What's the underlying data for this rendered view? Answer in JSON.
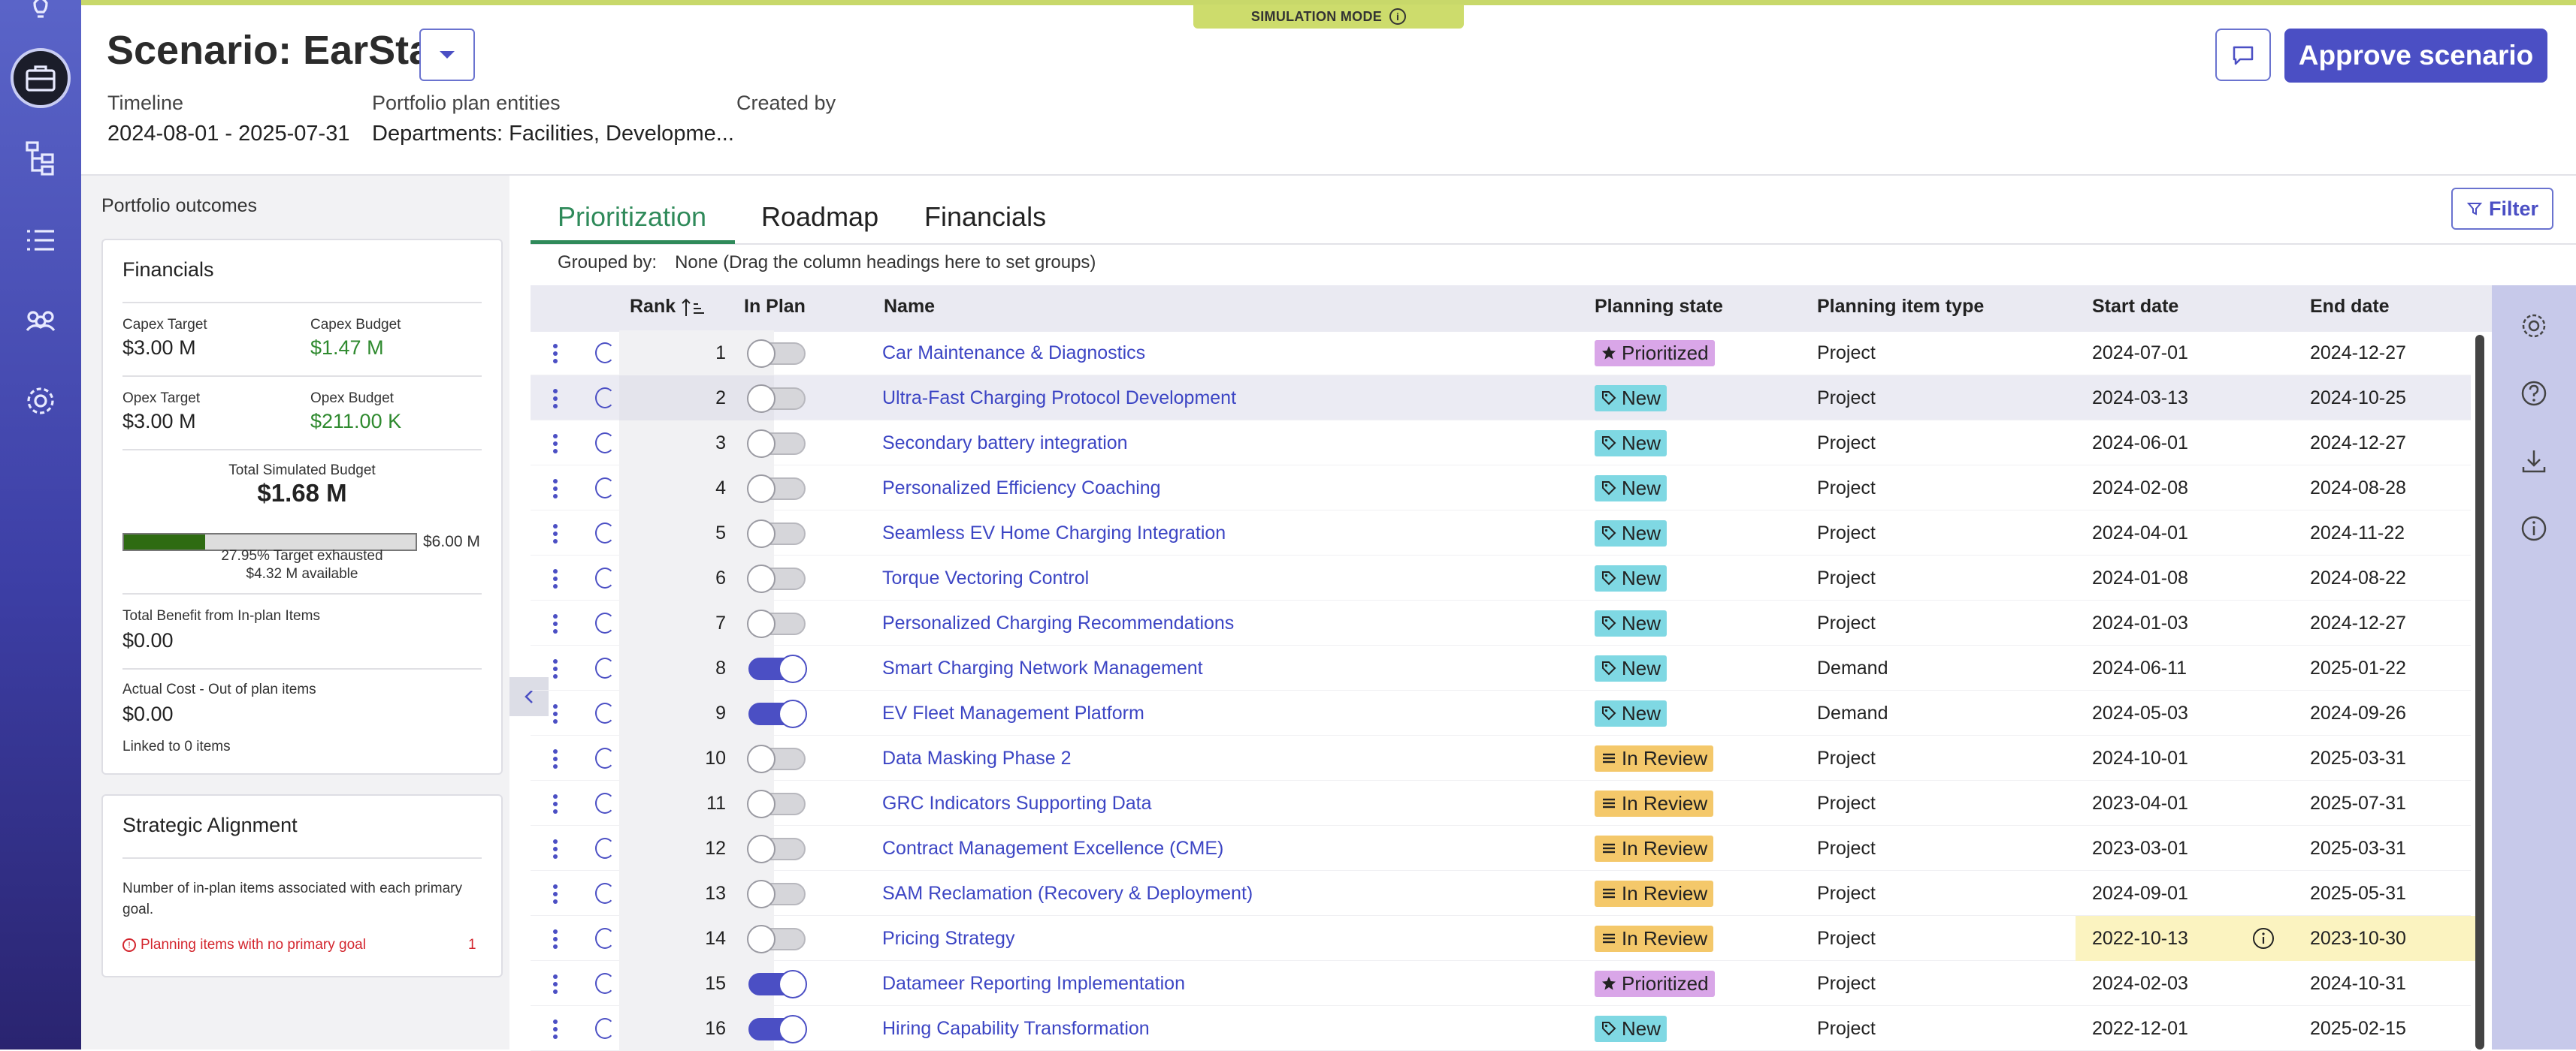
{
  "sim_mode": "SIMULATION MODE",
  "header": {
    "title": "Scenario: EarSta",
    "timeline_label": "Timeline",
    "timeline_value": "2024-08-01 - 2025-07-31",
    "entities_label": "Portfolio plan entities",
    "entities_value": "Departments: Facilities, Developme...",
    "created_label": "Created by",
    "approve_label": "Approve scenario"
  },
  "left_panel": {
    "title": "Portfolio outcomes",
    "financials": {
      "heading": "Financials",
      "capex_target_label": "Capex Target",
      "capex_target": "$3.00 M",
      "capex_budget_label": "Capex Budget",
      "capex_budget": "$1.47 M",
      "opex_target_label": "Opex Target",
      "opex_target": "$3.00 M",
      "opex_budget_label": "Opex Budget",
      "opex_budget": "$211.00 K",
      "total_sim_label": "Total Simulated Budget",
      "total_sim": "$1.68 M",
      "bar_max": "$6.00 M",
      "exhausted_fraction": 0.2795,
      "exhausted_text": "27.95% Target exhausted",
      "available_text": "$4.32 M available",
      "benefit_label": "Total Benefit from In-plan Items",
      "benefit_value": "$0.00",
      "actual_label": "Actual Cost - Out of plan items",
      "actual_value": "$0.00",
      "linked_text": "Linked to 0 items"
    },
    "strategic": {
      "heading": "Strategic Alignment",
      "desc": "Number of in-plan items associated with each primary goal.",
      "warning": "Planning items with no primary goal",
      "warning_count": "1"
    }
  },
  "tabs": [
    "Prioritization",
    "Roadmap",
    "Financials"
  ],
  "filter_label": "Filter",
  "grouped_by_label": "Grouped by:",
  "grouped_by_value": "None (Drag the column headings here to set groups)",
  "columns": [
    "Rank",
    "In Plan",
    "Name",
    "Planning state",
    "Planning item type",
    "Start date",
    "End date"
  ],
  "colors": {
    "accent": "#4b4fc4",
    "rail": "#3d3fa6",
    "active_tab": "#2f8a5a",
    "prioritized": "#d9a6e8",
    "new": "#7fd8e3",
    "in_review": "#f4c86a"
  },
  "rows": [
    {
      "rank": "1",
      "in_plan": false,
      "name": "Car Maintenance & Diagnostics",
      "state": "Prioritized",
      "type": "Project",
      "start": "2024-07-01",
      "end": "2024-12-27"
    },
    {
      "rank": "2",
      "in_plan": false,
      "name": "Ultra-Fast Charging Protocol Development",
      "state": "New",
      "type": "Project",
      "start": "2024-03-13",
      "end": "2024-10-25"
    },
    {
      "rank": "3",
      "in_plan": false,
      "name": "Secondary battery integration",
      "state": "New",
      "type": "Project",
      "start": "2024-06-01",
      "end": "2024-12-27"
    },
    {
      "rank": "4",
      "in_plan": false,
      "name": "Personalized Efficiency Coaching",
      "state": "New",
      "type": "Project",
      "start": "2024-02-08",
      "end": "2024-08-28"
    },
    {
      "rank": "5",
      "in_plan": false,
      "name": "Seamless EV Home Charging Integration",
      "state": "New",
      "type": "Project",
      "start": "2024-04-01",
      "end": "2024-11-22"
    },
    {
      "rank": "6",
      "in_plan": false,
      "name": "Torque Vectoring Control",
      "state": "New",
      "type": "Project",
      "start": "2024-01-08",
      "end": "2024-08-22"
    },
    {
      "rank": "7",
      "in_plan": false,
      "name": "Personalized Charging Recommendations",
      "state": "New",
      "type": "Project",
      "start": "2024-01-03",
      "end": "2024-12-27"
    },
    {
      "rank": "8",
      "in_plan": true,
      "name": "Smart Charging Network Management",
      "state": "New",
      "type": "Demand",
      "start": "2024-06-11",
      "end": "2025-01-22"
    },
    {
      "rank": "9",
      "in_plan": true,
      "name": "EV Fleet Management Platform",
      "state": "New",
      "type": "Demand",
      "start": "2024-05-03",
      "end": "2024-09-26"
    },
    {
      "rank": "10",
      "in_plan": false,
      "name": "Data Masking Phase 2",
      "state": "In Review",
      "type": "Project",
      "start": "2024-10-01",
      "end": "2025-03-31"
    },
    {
      "rank": "11",
      "in_plan": false,
      "name": "GRC Indicators Supporting Data",
      "state": "In Review",
      "type": "Project",
      "start": "2023-04-01",
      "end": "2025-07-31"
    },
    {
      "rank": "12",
      "in_plan": false,
      "name": "Contract Management Excellence (CME)",
      "state": "In Review",
      "type": "Project",
      "start": "2023-03-01",
      "end": "2025-03-31"
    },
    {
      "rank": "13",
      "in_plan": false,
      "name": "SAM Reclamation (Recovery & Deployment)",
      "state": "In Review",
      "type": "Project",
      "start": "2024-09-01",
      "end": "2025-05-31"
    },
    {
      "rank": "14",
      "in_plan": false,
      "name": "Pricing Strategy",
      "state": "In Review",
      "type": "Project",
      "start": "2022-10-13",
      "end": "2023-10-30",
      "warn": true
    },
    {
      "rank": "15",
      "in_plan": true,
      "name": "Datameer Reporting Implementation",
      "state": "Prioritized",
      "type": "Project",
      "start": "2024-02-03",
      "end": "2024-10-31"
    },
    {
      "rank": "16",
      "in_plan": true,
      "name": "Hiring Capability Transformation",
      "state": "New",
      "type": "Project",
      "start": "2022-12-01",
      "end": "2025-02-15"
    }
  ]
}
